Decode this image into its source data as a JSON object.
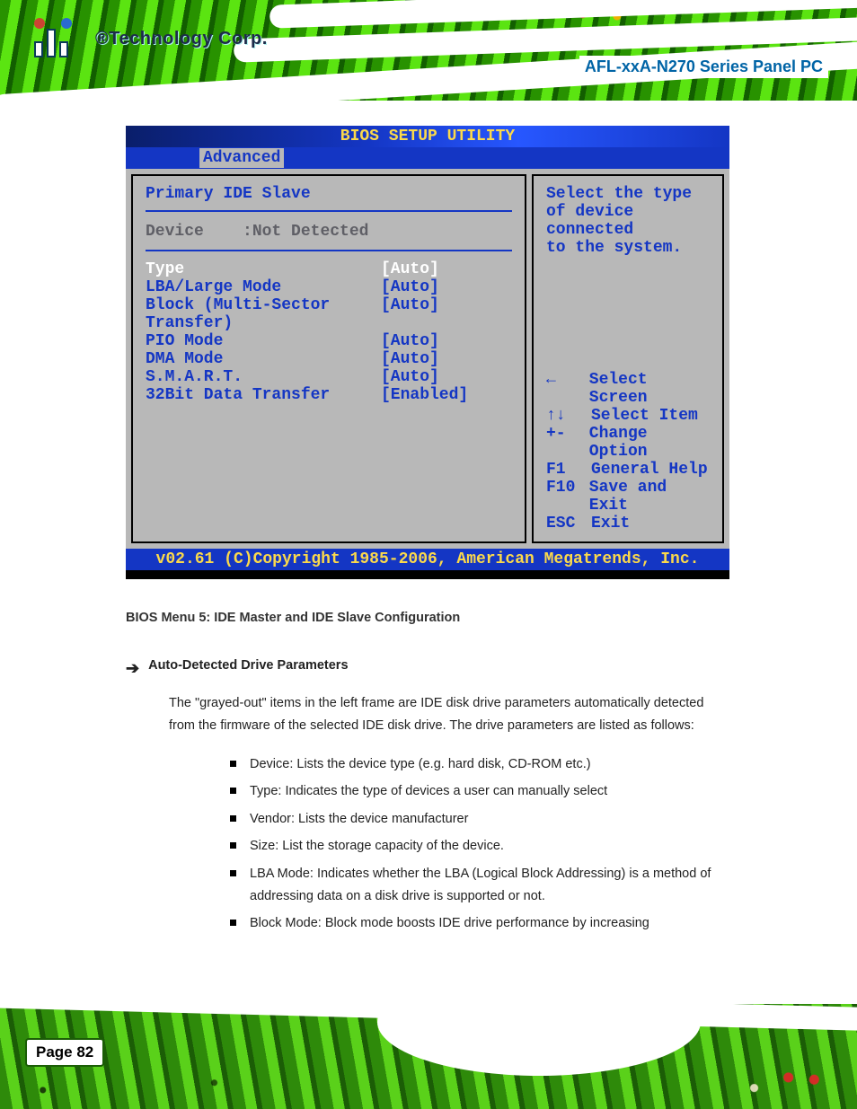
{
  "header": {
    "brand_trademark": "®",
    "brand_text": "Technology Corp.",
    "product": "AFL-xxA-N270 Series Panel PC"
  },
  "bios": {
    "title": "BIOS SETUP UTILITY",
    "active_tab": "Advanced",
    "section_title": "Primary IDE Slave",
    "device_label": "Device",
    "device_value": ":Not Detected",
    "rows": [
      {
        "label": "Type",
        "value": "[Auto]",
        "selected": true
      },
      {
        "label": "LBA/Large Mode",
        "value": "[Auto]",
        "selected": false
      },
      {
        "label": "Block (Multi-Sector Transfer)",
        "value": "[Auto]",
        "selected": false
      },
      {
        "label": "PIO Mode",
        "value": "[Auto]",
        "selected": false
      },
      {
        "label": "DMA Mode",
        "value": "[Auto]",
        "selected": false
      },
      {
        "label": "S.M.A.R.T.",
        "value": "[Auto]",
        "selected": false
      },
      {
        "label": "32Bit Data Transfer",
        "value": "[Enabled]",
        "selected": false
      }
    ],
    "help_lines": [
      "Select the type",
      "of device connected",
      "to the system."
    ],
    "keys": [
      {
        "k": "←",
        "d": "Select Screen"
      },
      {
        "k": "↑↓",
        "d": "Select Item"
      },
      {
        "k": "+-",
        "d": "Change Option"
      },
      {
        "k": "F1",
        "d": "General Help"
      },
      {
        "k": "F10",
        "d": "Save and Exit"
      },
      {
        "k": "ESC",
        "d": "Exit"
      }
    ],
    "footer": "v02.61 (C)Copyright 1985-2006, American Megatrends, Inc."
  },
  "doc": {
    "caption": "BIOS Menu 5: IDE Master and IDE Slave Configuration",
    "arrow_label": "Auto-Detected Drive Parameters",
    "paragraph": "The \"grayed-out\" items in the left frame are IDE disk drive parameters automatically detected from the firmware of the selected IDE disk drive. The drive parameters are listed as follows:",
    "bullets": [
      "Device: Lists the device type (e.g. hard disk, CD-ROM etc.)",
      "Type: Indicates the type of devices a user can manually select",
      "Vendor: Lists the device manufacturer",
      "Size: List the storage capacity of the device.",
      "LBA Mode: Indicates whether the LBA (Logical Block Addressing) is a method of addressing data on a disk drive is supported or not.",
      "Block Mode: Block mode boosts IDE drive performance by increasing"
    ]
  },
  "page_number": "Page 82"
}
